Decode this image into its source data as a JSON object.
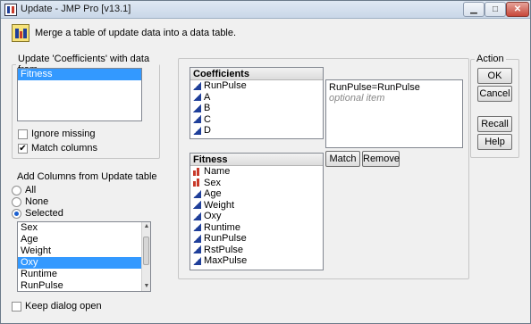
{
  "window": {
    "title": "Update - JMP Pro [v13.1]"
  },
  "header": {
    "text": "Merge a table of update data into a data table."
  },
  "update_group": {
    "legend": "Update 'Coefficients' with data from",
    "tables": [
      {
        "label": "Fitness",
        "selected": true
      }
    ],
    "ignore_missing": {
      "label": "Ignore missing",
      "checked": false
    },
    "match_columns": {
      "label": "Match columns",
      "checked": true
    }
  },
  "add_columns": {
    "label": "Add Columns from Update table",
    "options": [
      {
        "label": "All",
        "selected": false
      },
      {
        "label": "None",
        "selected": false
      },
      {
        "label": "Selected",
        "selected": true
      }
    ],
    "list": [
      {
        "label": "Sex",
        "selected": false
      },
      {
        "label": "Age",
        "selected": false
      },
      {
        "label": "Weight",
        "selected": false
      },
      {
        "label": "Oxy",
        "selected": true
      },
      {
        "label": "Runtime",
        "selected": false
      },
      {
        "label": "RunPulse",
        "selected": false
      }
    ]
  },
  "keep_open": {
    "label": "Keep dialog open",
    "checked": false
  },
  "coefficients": {
    "title": "Coefficients",
    "columns": [
      {
        "label": "RunPulse",
        "icon": "continuous-icon"
      },
      {
        "label": "A",
        "icon": "continuous-icon"
      },
      {
        "label": "B",
        "icon": "continuous-icon"
      },
      {
        "label": "C",
        "icon": "continuous-icon"
      },
      {
        "label": "D",
        "icon": "continuous-icon"
      }
    ]
  },
  "match_area": {
    "pair": "RunPulse=RunPulse",
    "optional": "optional item"
  },
  "match_buttons": {
    "match": "Match",
    "remove": "Remove"
  },
  "fitness": {
    "title": "Fitness",
    "columns": [
      {
        "label": "Name",
        "icon": "nominal-icon"
      },
      {
        "label": "Sex",
        "icon": "nominal-icon"
      },
      {
        "label": "Age",
        "icon": "continuous-icon"
      },
      {
        "label": "Weight",
        "icon": "continuous-icon"
      },
      {
        "label": "Oxy",
        "icon": "continuous-icon"
      },
      {
        "label": "Runtime",
        "icon": "continuous-icon"
      },
      {
        "label": "RunPulse",
        "icon": "continuous-icon"
      },
      {
        "label": "RstPulse",
        "icon": "continuous-icon"
      },
      {
        "label": "MaxPulse",
        "icon": "continuous-icon"
      }
    ]
  },
  "action": {
    "legend": "Action",
    "ok": "OK",
    "cancel": "Cancel",
    "recall": "Recall",
    "help": "Help"
  },
  "colors": {
    "selection": "#3399ff",
    "continuous": "#1f3f9a",
    "nominal": "#c83a2a"
  }
}
